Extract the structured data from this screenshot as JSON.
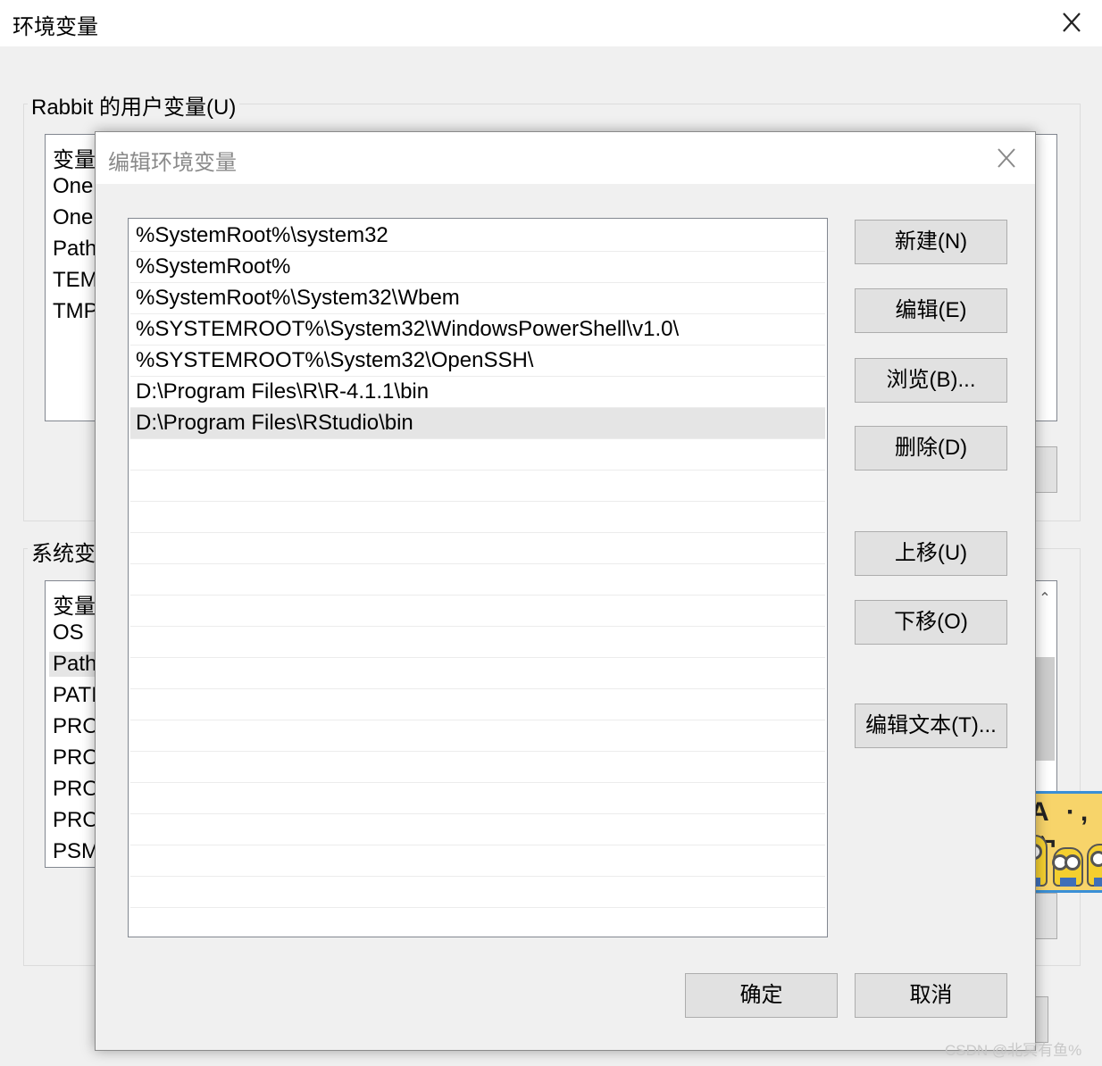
{
  "outer_window": {
    "title": "环境变量",
    "user_group_label": "Rabbit 的用户变量(U)",
    "user_list": [
      "变量",
      "One",
      "One",
      "Path",
      "TEM",
      "TMP"
    ],
    "system_group_label": "系统变",
    "system_list": [
      "变量",
      "OS",
      "Path",
      "PATI",
      "PRO",
      "PRO",
      "PRO",
      "PRO",
      "PSM"
    ]
  },
  "dialog": {
    "title": "编辑环境变量",
    "paths": [
      "%SystemRoot%\\system32",
      "%SystemRoot%",
      "%SystemRoot%\\System32\\Wbem",
      "%SYSTEMROOT%\\System32\\WindowsPowerShell\\v1.0\\",
      "%SYSTEMROOT%\\System32\\OpenSSH\\",
      "D:\\Program Files\\R\\R-4.1.1\\bin",
      "D:\\Program Files\\RStudio\\bin"
    ],
    "selected_index": 6,
    "buttons": {
      "new": "新建(N)",
      "edit": "编辑(E)",
      "browse": "浏览(B)...",
      "delete": "删除(D)",
      "move_up": "上移(U)",
      "move_down": "下移(O)",
      "edit_text": "编辑文本(T)...",
      "ok": "确定",
      "cancel": "取消"
    }
  },
  "sticker_text": "A ·, 宀",
  "watermark": "CSDN @北冥有鱼%"
}
